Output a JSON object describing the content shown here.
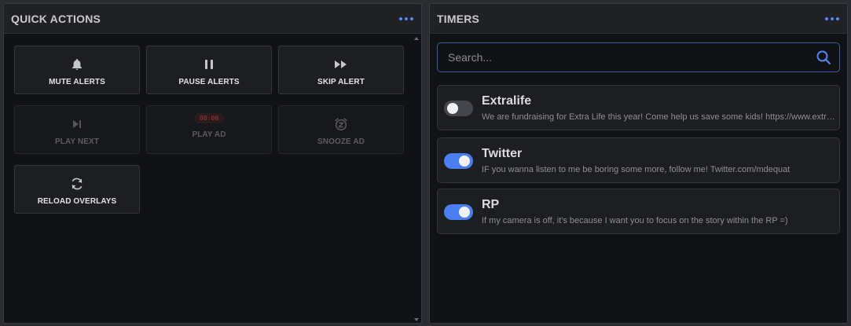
{
  "quick_actions": {
    "title": "QUICK ACTIONS",
    "menu_icon": "more-horizontal-icon",
    "buttons": [
      {
        "label": "MUTE ALERTS",
        "icon": "bell-icon",
        "enabled": true
      },
      {
        "label": "PAUSE ALERTS",
        "icon": "pause-icon",
        "enabled": true
      },
      {
        "label": "SKIP ALERT",
        "icon": "fast-forward-icon",
        "enabled": true
      },
      {
        "label": "PLAY NEXT",
        "icon": "skip-next-icon",
        "enabled": false
      },
      {
        "label": "PLAY AD",
        "timer": "00:00",
        "enabled": false
      },
      {
        "label": "SNOOZE AD",
        "icon": "snooze-alarm-icon",
        "enabled": false
      },
      {
        "label": "RELOAD OVERLAYS",
        "icon": "refresh-icon",
        "enabled": true
      }
    ]
  },
  "timers": {
    "title": "TIMERS",
    "menu_icon": "more-horizontal-icon",
    "search": {
      "placeholder": "Search...",
      "value": ""
    },
    "items": [
      {
        "name": "Extralife",
        "message": "We are fundraising for Extra Life this year! Come help us save some kids! https://www.extra-life.org",
        "enabled": false
      },
      {
        "name": "Twitter",
        "message": "IF you wanna listen to me be boring some more, follow me! Twitter.com/mdequat",
        "enabled": true
      },
      {
        "name": "RP",
        "message": "If my camera is off, it's because I want you to focus on the story within the RP =)",
        "enabled": true
      }
    ]
  },
  "colors": {
    "accent": "#4b7ef0",
    "panel_bg": "#111214",
    "header_bg": "#202125",
    "ad_timer": "#a8342f"
  }
}
